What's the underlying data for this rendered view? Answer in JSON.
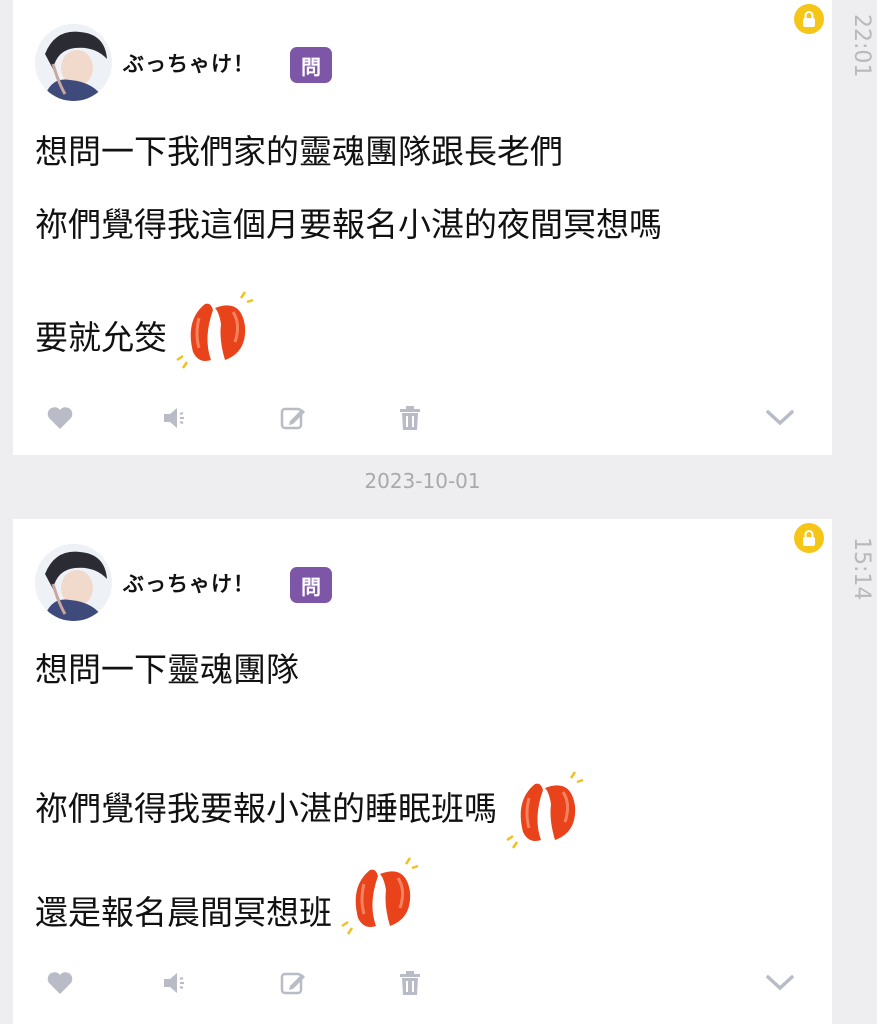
{
  "entries": [
    {
      "time": "22:01",
      "author": "ぶっちゃけ！",
      "badge": "問",
      "lines": [
        "想問一下我們家的靈魂團隊跟長老們",
        "祢們覺得我這個月要報名小湛的夜間冥想嗎",
        "要就允筊"
      ]
    },
    {
      "time": "15:14",
      "author": "ぶっちゃけ！",
      "badge": "問",
      "lines": [
        "想問一下靈魂團隊",
        "祢們覺得我要報小湛的睡眠班嗎",
        "還是報名晨間冥想班"
      ]
    }
  ],
  "date_separator": "2023-10-01",
  "icons": {
    "like": "heart-icon",
    "voice": "speaker-icon",
    "edit": "edit-icon",
    "delete": "trash-icon",
    "expand": "chevron-down-icon",
    "lock": "lock-icon",
    "emoji": "moon-blocks-icon"
  },
  "colors": {
    "badge": "#7e56a8",
    "lock": "#f5c518",
    "icon_gray": "#b9bcc6",
    "moon_block": "#e8431a"
  }
}
